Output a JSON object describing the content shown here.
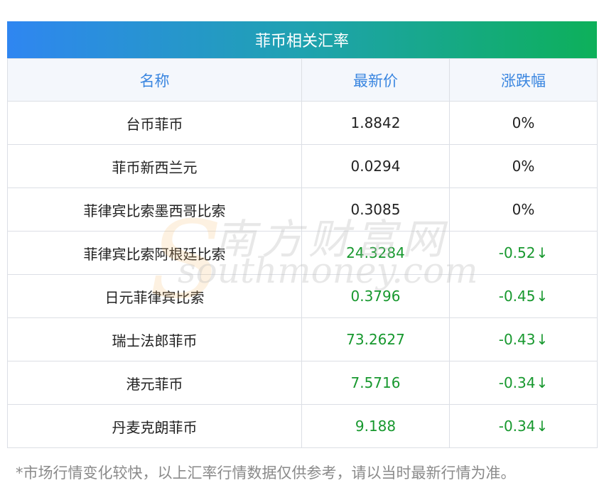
{
  "table": {
    "title": "菲币相关汇率",
    "headers": {
      "name": "名称",
      "price": "最新价",
      "change": "涨跌幅"
    },
    "rows": [
      {
        "name": "台币菲币",
        "price": "1.8842",
        "change": "0%",
        "direction": "flat",
        "arrow": ""
      },
      {
        "name": "菲币新西兰元",
        "price": "0.0294",
        "change": "0%",
        "direction": "flat",
        "arrow": ""
      },
      {
        "name": "菲律宾比索墨西哥比索",
        "price": "0.3085",
        "change": "0%",
        "direction": "flat",
        "arrow": ""
      },
      {
        "name": "菲律宾比索阿根廷比索",
        "price": "24.3284",
        "change": "-0.52",
        "direction": "down",
        "arrow": "↓"
      },
      {
        "name": "日元菲律宾比索",
        "price": "0.3796",
        "change": "-0.45",
        "direction": "down",
        "arrow": "↓"
      },
      {
        "name": "瑞士法郎菲币",
        "price": "73.2627",
        "change": "-0.43",
        "direction": "down",
        "arrow": "↓"
      },
      {
        "name": "港元菲币",
        "price": "7.5716",
        "change": "-0.34",
        "direction": "down",
        "arrow": "↓"
      },
      {
        "name": "丹麦克朗菲币",
        "price": "9.188",
        "change": "-0.34",
        "direction": "down",
        "arrow": "↓"
      }
    ]
  },
  "watermark": {
    "cn": "南方财富网",
    "en": "southmoney.com"
  },
  "footnote": "*市场行情变化较快，以上汇率行情数据仅供参考，请以当时最新行情为准。",
  "colors": {
    "title_gradient_start": "#2f86f1",
    "title_gradient_end": "#0db05a",
    "header_text": "#3a86e0",
    "down": "#17982e",
    "footnote": "#8a8a8a"
  }
}
